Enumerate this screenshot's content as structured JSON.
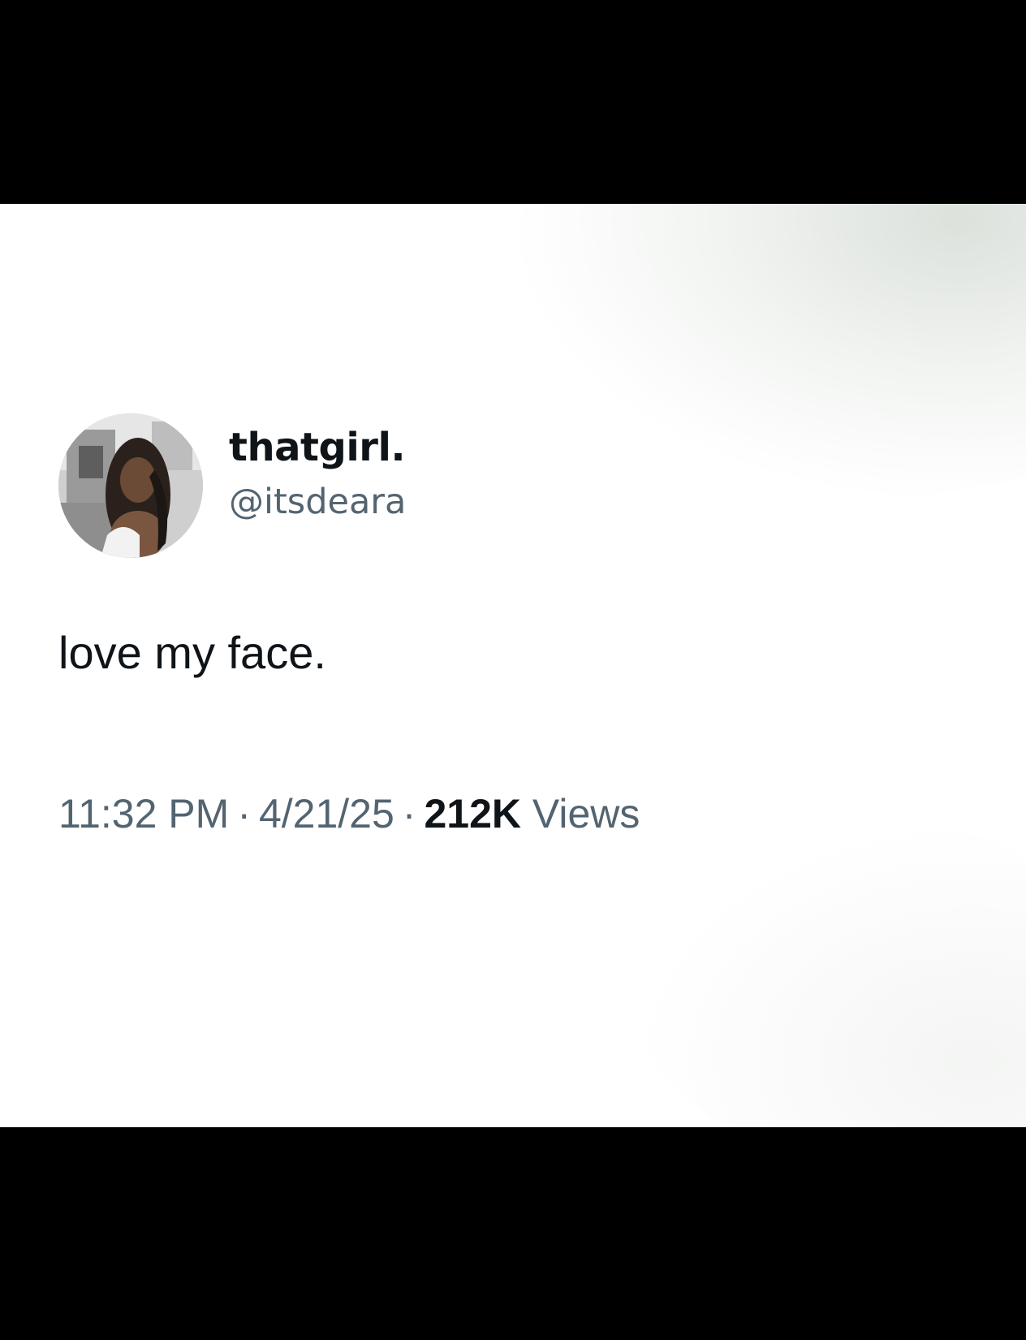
{
  "tweet": {
    "author": {
      "display_name": "thatgirl.",
      "handle": "@itsdeara",
      "avatar_icon": "user-photo-avatar"
    },
    "text": "love my face.",
    "meta": {
      "time": "11:32 PM",
      "date": "4/21/25",
      "separator": "·",
      "views_count": "212K",
      "views_label": "Views"
    }
  },
  "colors": {
    "background": "#ffffff",
    "letterbox": "#000000",
    "primary_text": "#0f1419",
    "secondary_text": "#536471"
  }
}
